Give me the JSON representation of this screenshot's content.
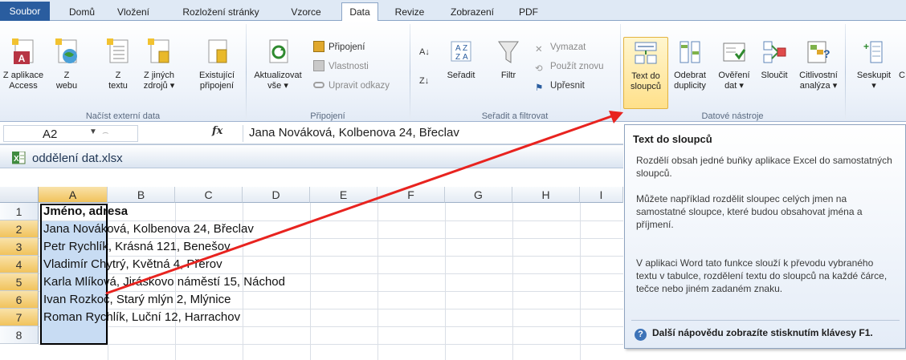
{
  "ribbon_tabs": [
    {
      "label": "Soubor"
    },
    {
      "label": "Domů"
    },
    {
      "label": "Vložení"
    },
    {
      "label": "Rozložení stránky"
    },
    {
      "label": "Vzorce"
    },
    {
      "label": "Data"
    },
    {
      "label": "Revize"
    },
    {
      "label": "Zobrazení"
    },
    {
      "label": "PDF"
    }
  ],
  "active_tab": "Data",
  "groups": {
    "external": {
      "label": "Načíst externí data",
      "buttons": [
        {
          "line1": "Z aplikace",
          "line2": "Access"
        },
        {
          "line1": "Z",
          "line2": "webu"
        },
        {
          "line1": "Z",
          "line2": "textu"
        },
        {
          "line1": "Z jiných",
          "line2": "zdrojů ▾"
        },
        {
          "line1": "Existující",
          "line2": "připojení"
        }
      ]
    },
    "connections": {
      "label": "Připojení",
      "refresh": {
        "line1": "Aktualizovat",
        "line2": "vše ▾"
      },
      "connections": "Připojení",
      "properties": "Vlastnosti",
      "edit_links": "Upravit odkazy"
    },
    "sort": {
      "label": "Seřadit a filtrovat",
      "sort": "Seřadit",
      "filter": "Filtr",
      "clear": "Vymazat",
      "reapply": "Použít znovu",
      "advanced": "Upřesnit"
    },
    "tools": {
      "label": "Datové nástroje",
      "buttons": [
        {
          "line1": "Text do",
          "line2": "sloupců"
        },
        {
          "line1": "Odebrat",
          "line2": "duplicity"
        },
        {
          "line1": "Ověření",
          "line2": "dat ▾"
        },
        {
          "line1": "Sloučit",
          "line2": ""
        },
        {
          "line1": "Citlivostní",
          "line2": "analýza ▾"
        }
      ]
    },
    "outline": {
      "group": {
        "line1": "Seskupit",
        "line2": "▾"
      },
      "truncated": "C"
    }
  },
  "formula_bar": {
    "name_box": "A2",
    "fx": "fx",
    "content": "Jana Nováková, Kolbenova 24, Břeclav"
  },
  "workbook": {
    "title": "oddělení dat.xlsx",
    "columns": [
      "A",
      "B",
      "C",
      "D",
      "E",
      "F",
      "G",
      "H",
      "I"
    ],
    "rows": [
      {
        "num": "1",
        "text": "Jméno, adresa",
        "bold": true
      },
      {
        "num": "2",
        "text": "Jana Nováková, Kolbenova 24, Břeclav"
      },
      {
        "num": "3",
        "text": "Petr Rychlík, Krásná 121, Benešov"
      },
      {
        "num": "4",
        "text": "Vladimír Chytrý, Květná 4, Přerov"
      },
      {
        "num": "5",
        "text": "Karla Mlíková, Jiráskovo náměstí 15, Náchod"
      },
      {
        "num": "6",
        "text": "Ivan Rozkoč, Starý mlýn 2, Mlýnice"
      },
      {
        "num": "7",
        "text": "Roman Rychlík, Luční 12, Harrachov"
      },
      {
        "num": "8",
        "text": ""
      }
    ]
  },
  "tooltip": {
    "title": "Text do sloupců",
    "p1": "Rozdělí obsah jedné buňky aplikace Excel do samostatných sloupců.",
    "p2": "Můžete například rozdělit sloupec celých jmen na samostatné sloupce, které budou obsahovat jména a příjmení.",
    "p3": "V aplikaci Word tato funkce slouží k převodu vybraného textu v tabulce, rozdělení textu do sloupců na každé čárce, tečce nebo jiném zadaném znaku.",
    "help": "Další nápovědu zobrazíte stisknutím klávesy F1."
  },
  "colors": {
    "file_tab": "#2a5d9f",
    "selection_fill": "#c8dcf3",
    "arrow": "#e8231f",
    "header_selected": "#f1c35c"
  }
}
